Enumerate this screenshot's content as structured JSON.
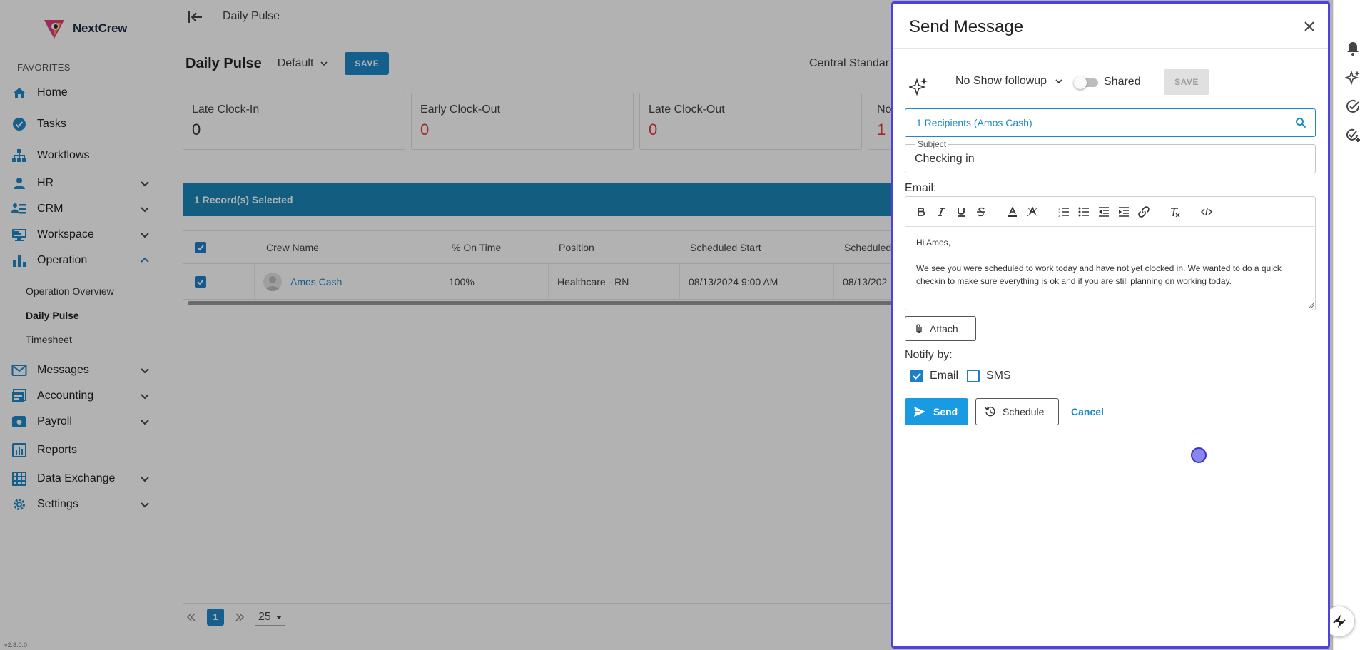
{
  "app": {
    "name": "NextCrew",
    "version": "v2.8.0.0"
  },
  "sidebar": {
    "favorites_label": "FAVORITES",
    "items": [
      {
        "key": "home",
        "label": "Home"
      },
      {
        "key": "tasks",
        "label": "Tasks"
      },
      {
        "key": "workflows",
        "label": "Workflows"
      },
      {
        "key": "hr",
        "label": "HR"
      },
      {
        "key": "crm",
        "label": "CRM"
      },
      {
        "key": "workspace",
        "label": "Workspace"
      },
      {
        "key": "operation",
        "label": "Operation"
      },
      {
        "key": "messages",
        "label": "Messages"
      },
      {
        "key": "accounting",
        "label": "Accounting"
      },
      {
        "key": "payroll",
        "label": "Payroll"
      },
      {
        "key": "reports",
        "label": "Reports"
      },
      {
        "key": "data_exchange",
        "label": "Data Exchange"
      },
      {
        "key": "settings",
        "label": "Settings"
      }
    ],
    "operation_subitems": [
      "Operation Overview",
      "Daily Pulse",
      "Timesheet"
    ],
    "active_subitem": "Daily Pulse"
  },
  "header": {
    "breadcrumb": "Daily Pulse"
  },
  "page": {
    "title": "Daily Pulse",
    "view_select": "Default",
    "save_label": "SAVE",
    "timezone": "Central Standar"
  },
  "stats": [
    {
      "label": "Late Clock-In",
      "value": "0",
      "alert": false
    },
    {
      "label": "Early Clock-Out",
      "value": "0",
      "alert": true
    },
    {
      "label": "Late Clock-Out",
      "value": "0",
      "alert": true
    },
    {
      "label": "No",
      "value": "1",
      "alert": true
    }
  ],
  "selection_bar": {
    "text": "1 Record(s) Selected"
  },
  "grid": {
    "columns": [
      "Crew Name",
      "% On Time",
      "Position",
      "Scheduled Start",
      "Scheduled"
    ],
    "rows": [
      {
        "crew_name": "Amos Cash",
        "on_time": "100%",
        "position": "Healthcare - RN",
        "scheduled_start": "08/13/2024 9:00 AM",
        "scheduled_end": "08/13/202"
      }
    ]
  },
  "pagination": {
    "current_page": "1",
    "page_size": "25"
  },
  "drawer": {
    "title": "Send Message",
    "template_select": "No Show followup",
    "shared_label": "Shared",
    "save_label": "SAVE",
    "recipients": "1 Recipients (Amos Cash)",
    "subject_label": "Subject",
    "subject_value": "Checking in",
    "email_label": "Email:",
    "email_body": [
      "Hi  Amos,",
      "We see you were scheduled to work today and have not yet clocked in. We wanted to do a quick checkin to make sure everything is ok and if you are still planning on working today."
    ],
    "attach_label": "Attach",
    "notify_label": "Notify by:",
    "notify_options": [
      {
        "label": "Email",
        "checked": true
      },
      {
        "label": "SMS",
        "checked": false
      }
    ],
    "send_label": "Send",
    "schedule_label": "Schedule",
    "cancel_label": "Cancel"
  },
  "colors": {
    "accent": "#1e88c9",
    "selection_bar": "#1a86b8",
    "alert": "#e53935",
    "drawer_border": "#4a43e0"
  },
  "icons": {
    "sidebar": [
      "home-icon",
      "tasks-icon",
      "workflows-icon",
      "hr-icon",
      "crm-icon",
      "workspace-icon",
      "operation-icon",
      "messages-icon",
      "accounting-icon",
      "payroll-icon",
      "reports-icon",
      "data-exchange-icon",
      "settings-icon"
    ],
    "rail": [
      "bell-icon",
      "sparkle-icon",
      "check-circle-icon",
      "check-circle-plus-icon"
    ]
  }
}
